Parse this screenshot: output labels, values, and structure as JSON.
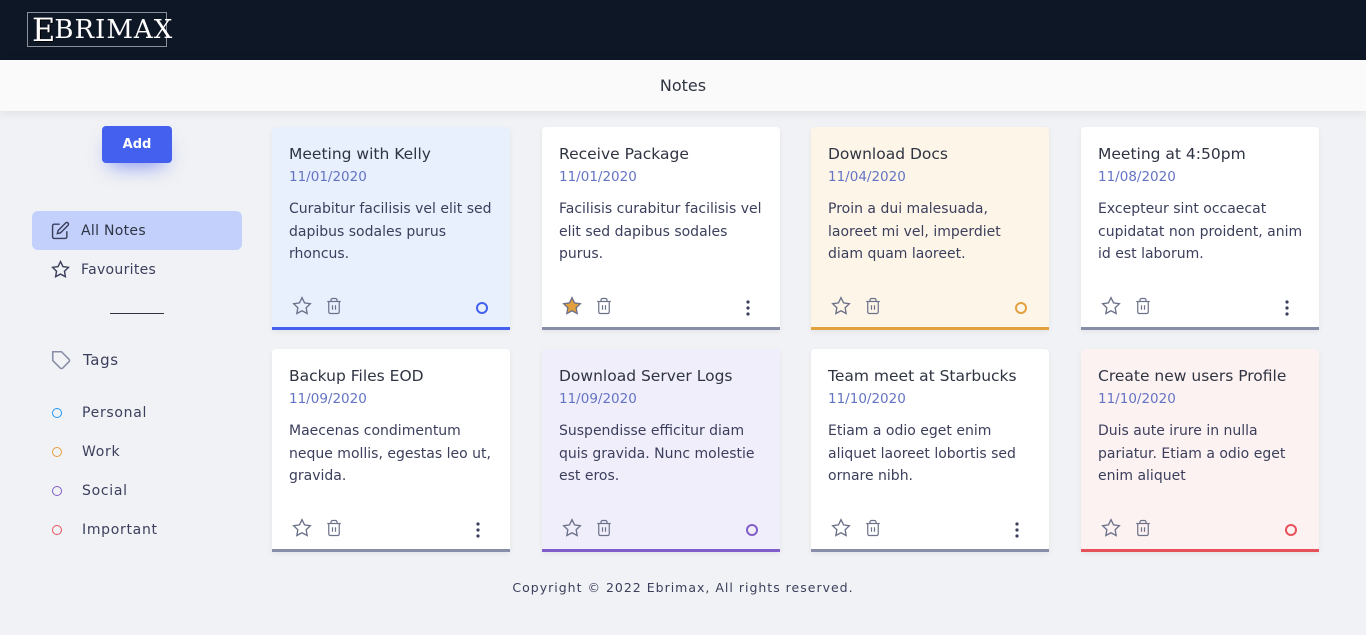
{
  "brand": {
    "logo_big": "E",
    "logo_rest": "BRIMAX"
  },
  "header": {
    "title": "Notes"
  },
  "sidebar": {
    "add_label": "Add",
    "nav": [
      {
        "label": "All Notes",
        "icon": "edit-icon",
        "active": true
      },
      {
        "label": "Favourites",
        "icon": "star-icon",
        "active": false
      }
    ],
    "tags_label": "Tags",
    "tags": [
      {
        "label": "Personal",
        "color": "#2196f3"
      },
      {
        "label": "Work",
        "color": "#e2a03f"
      },
      {
        "label": "Social",
        "color": "#805dca"
      },
      {
        "label": "Important",
        "color": "#e7515a"
      }
    ]
  },
  "notes": [
    {
      "title": "Meeting with Kelly",
      "date": "11/01/2020",
      "body": "Curabitur facilisis vel elit sed dapibus sodales purus rhoncus.",
      "tag": "personal",
      "bg": "#e8effd",
      "border": "#4361ee",
      "favourite": false
    },
    {
      "title": "Receive Package",
      "date": "11/01/2020",
      "body": "Facilisis curabitur facilisis vel elit sed dapibus sodales purus.",
      "tag": "",
      "bg": "#ffffff",
      "border": "#888ea8",
      "favourite": true
    },
    {
      "title": "Download Docs",
      "date": "11/04/2020",
      "body": "Proin a dui malesuada, laoreet mi vel, imperdiet diam quam laoreet.",
      "tag": "work",
      "bg": "#fdf5e8",
      "border": "#e2a03f",
      "favourite": false
    },
    {
      "title": "Meeting at 4:50pm",
      "date": "11/08/2020",
      "body": "Excepteur sint occaecat cupidatat non proident, anim id est laborum.",
      "tag": "",
      "bg": "#ffffff",
      "border": "#888ea8",
      "favourite": false
    },
    {
      "title": "Backup Files EOD",
      "date": "11/09/2020",
      "body": "Maecenas condimentum neque mollis, egestas leo ut, gravida.",
      "tag": "",
      "bg": "#ffffff",
      "border": "#888ea8",
      "favourite": false
    },
    {
      "title": "Download Server Logs",
      "date": "11/09/2020",
      "body": "Suspendisse efficitur diam quis gravida. Nunc molestie est eros.",
      "tag": "social",
      "bg": "#f1eefc",
      "border": "#805dca",
      "favourite": false
    },
    {
      "title": "Team meet at Starbucks",
      "date": "11/10/2020",
      "body": "Etiam a odio eget enim aliquet laoreet lobortis sed ornare nibh.",
      "tag": "",
      "bg": "#ffffff",
      "border": "#888ea8",
      "favourite": false
    },
    {
      "title": "Create new users Profile",
      "date": "11/10/2020",
      "body": "Duis aute irure in nulla pariatur. Etiam a odio eget enim aliquet",
      "tag": "important",
      "bg": "#fdf2f2",
      "border": "#e7515a",
      "favourite": false
    }
  ],
  "colors": {
    "star_filled": "#e2a03f",
    "accent": "#4361ee"
  },
  "footer": {
    "copyright": "Copyright © 2022 Ebrimax, All rights reserved."
  }
}
